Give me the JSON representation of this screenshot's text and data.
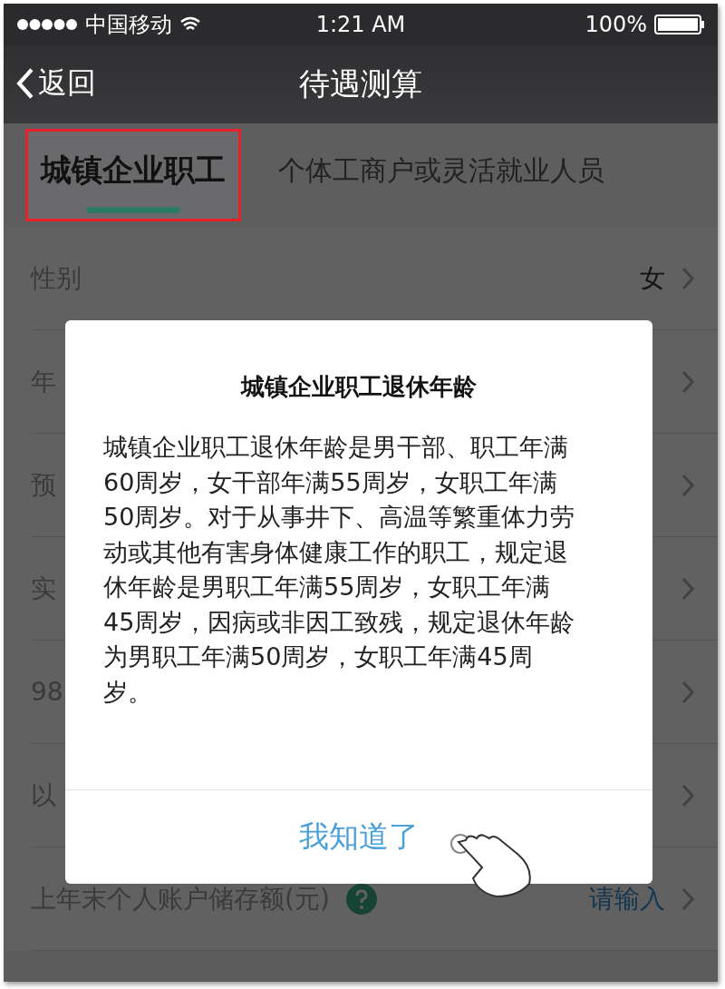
{
  "status_bar": {
    "carrier": "中国移动",
    "time": "1:21 AM",
    "battery": "100%"
  },
  "nav": {
    "back": "返回",
    "title": "待遇测算"
  },
  "tabs": [
    {
      "label": "城镇企业职工",
      "selected": true,
      "annotated": true
    },
    {
      "label": "个体工商户或灵活就业人员",
      "selected": false,
      "annotated": false
    }
  ],
  "rows": [
    {
      "label": "性别",
      "value": "女",
      "help": false
    },
    {
      "label": "年"
    },
    {
      "label": "预"
    },
    {
      "label": "实"
    },
    {
      "label": "98"
    },
    {
      "label": "以"
    },
    {
      "label": "上年末个人账户储存额(元)",
      "value": "请输入",
      "help": true
    }
  ],
  "dialog": {
    "title": "城镇企业职工退休年龄",
    "body": "城镇企业职工退休年龄是男干部、职工年满60周岁，女干部年满55周岁，女职工年满50周岁。对于从事井下、高温等繁重体力劳动或其他有害身体健康工作的职工，规定退休年龄是男职工年满55周岁，女职工年满45周岁，因病或非因工致残，规定退休年龄为男职工年满50周岁，女职工年满45周岁。",
    "button": "我知道了"
  }
}
